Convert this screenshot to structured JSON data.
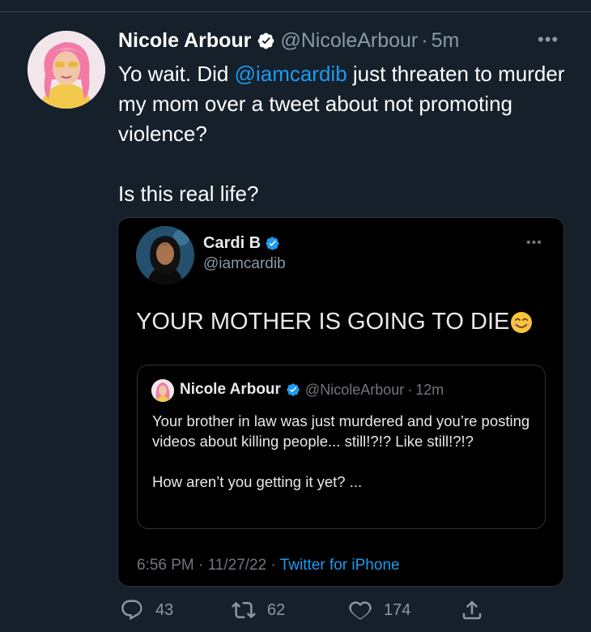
{
  "tweet": {
    "display_name": "Nicole Arbour",
    "handle": "@NicoleArbour",
    "separator": "·",
    "time": "5m",
    "more_glyph": "•••",
    "text_before_mention": "Yo wait. Did ",
    "mention": "@iamcardib",
    "text_after_mention": " just threaten to murder my mom over a tweet about not promoting violence?",
    "text_second_paragraph": "Is this real life?"
  },
  "embedded_tweet": {
    "display_name": "Cardi B",
    "handle": "@iamcardib",
    "more_glyph": "•••",
    "text": "YOUR MOTHER IS GOING TO DIE",
    "emoji": "smiling-face-emoji",
    "timestamp": "6:56 PM · 11/27/22 · ",
    "source": "Twitter for iPhone",
    "quoted_tweet": {
      "display_name": "Nicole Arbour",
      "handle": "@NicoleArbour",
      "separator": "·",
      "time": "12m",
      "text_line1": "Your brother in law was just murdered and you’re posting videos about killing people... still!?!? Like still!?!?",
      "text_line2": "How aren’t you getting it yet? ..."
    }
  },
  "actions": {
    "replies": "43",
    "retweets": "62",
    "likes": "174"
  },
  "colors": {
    "background": "#15202b",
    "card_background": "#000000",
    "accent": "#1d9bf0",
    "muted_text": "#8b98a5"
  },
  "icons": [
    "verified-badge-icon",
    "more-icon",
    "reply-icon",
    "retweet-icon",
    "like-icon",
    "share-icon"
  ]
}
